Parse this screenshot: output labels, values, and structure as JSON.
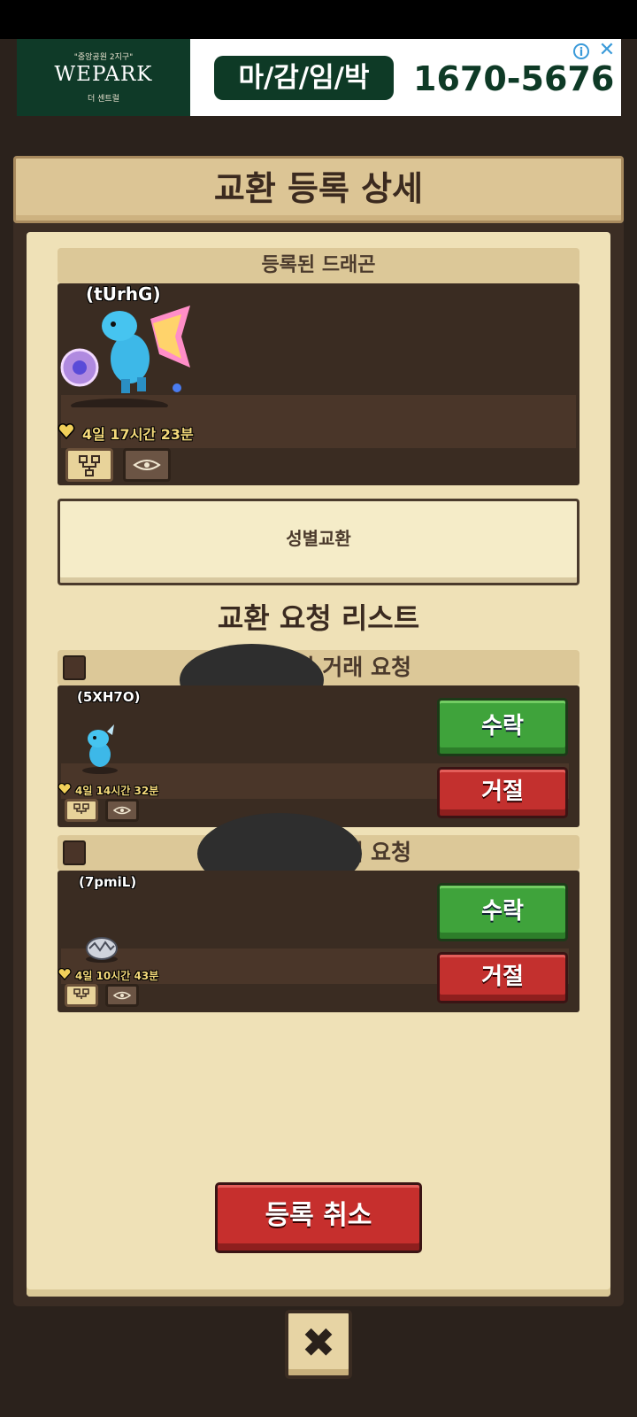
{
  "ad": {
    "logo_sub": "\"중앙공원 2지구\"",
    "logo_brand": "WEPARK",
    "logo_sub2": "더 센트럴",
    "pill_text": "마/감/임/박",
    "phone": "1670-5676",
    "info_glyph": "i",
    "close_glyph": "✕"
  },
  "title": "교환 등록 상세",
  "registered": {
    "label": "등록된 드래곤",
    "name": "(tUrhG)",
    "timer": "4일 17시간 23분"
  },
  "option": "성별교환",
  "list_title": "교환 요청 리스트",
  "requests": [
    {
      "header": "님의 거래 요청",
      "name": "(5XH7O)",
      "timer": "4일 14시간 32분",
      "accept": "수락",
      "reject": "거절"
    },
    {
      "header": "님의 거래 요청",
      "name": "(7pmiL)",
      "timer": "4일 10시간 43분",
      "accept": "수락",
      "reject": "거절"
    }
  ],
  "cancel": "등록 취소",
  "close": "✖",
  "colors": {
    "accept": "#3fa33b",
    "reject": "#c3302e",
    "paper": "#efe1b7",
    "banner": "#dcc595"
  }
}
